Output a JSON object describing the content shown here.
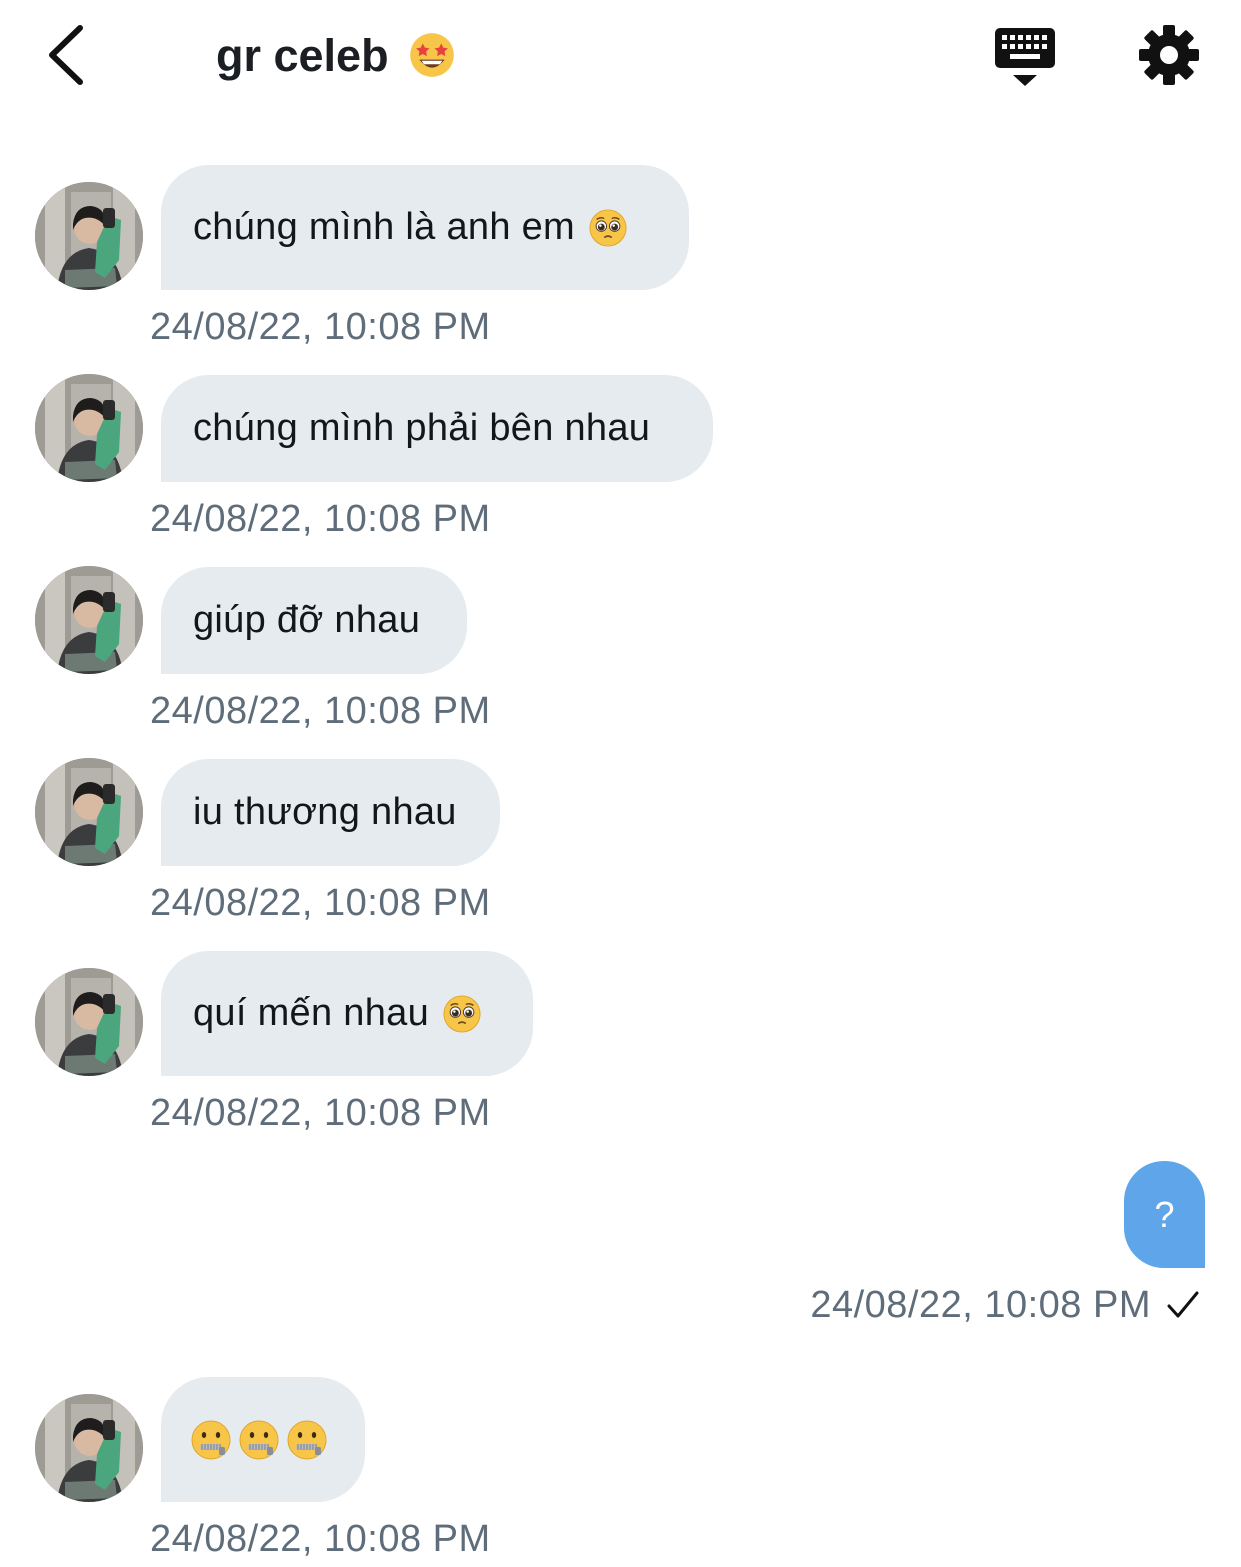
{
  "header": {
    "title": "gr celeb",
    "title_emoji": "star-struck-emoji",
    "back_icon": "chevron-left-icon",
    "keyboard_icon": "keyboard-hide-icon",
    "settings_icon": "gear-icon"
  },
  "messages": [
    {
      "text": "chúng mình là anh em",
      "emoji": "pleading-face-emoji",
      "time": "24/08/22, 10:08 PM"
    },
    {
      "text": "chúng mình phải bên nhau",
      "time": "24/08/22, 10:08 PM"
    },
    {
      "text": "giúp đỡ nhau",
      "time": "24/08/22, 10:08 PM"
    },
    {
      "text": "iu thương nhau",
      "time": "24/08/22, 10:08 PM"
    },
    {
      "text": "quí mến nhau",
      "emoji": "pleading-face-emoji",
      "time": "24/08/22, 10:08 PM"
    },
    {
      "text": "",
      "emoji": "zipper-mouth-face-emoji x3",
      "time": "24/08/22, 10:08 PM"
    }
  ],
  "outgoing": {
    "text": "?",
    "time": "24/08/22, 10:08 PM",
    "status_icon": "checkmark-icon"
  },
  "colors": {
    "incoming_bubble": "#e6ebef",
    "outgoing_bubble": "#5ea5ea",
    "timestamp": "#5f6d7a"
  }
}
